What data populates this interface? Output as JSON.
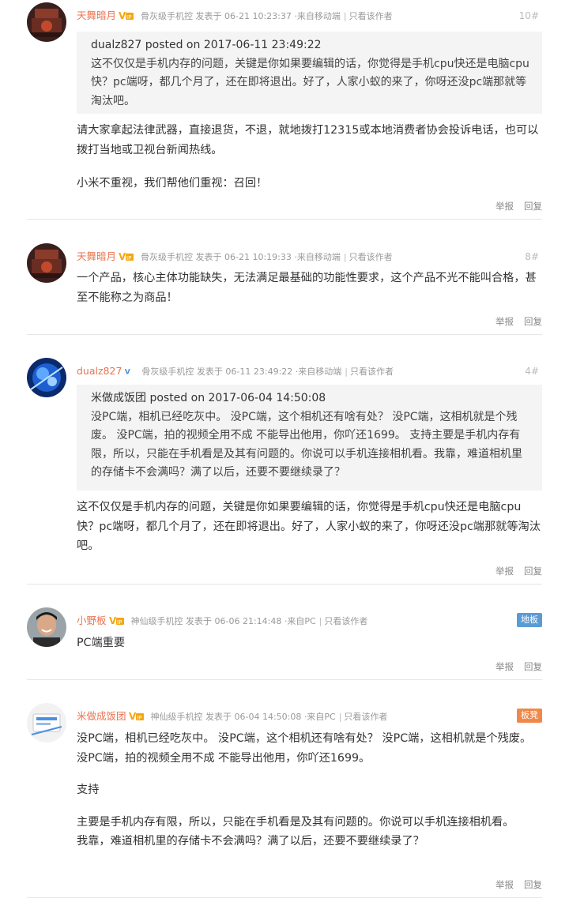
{
  "posts": [
    {
      "username": "天舞暗月",
      "rank": "骨灰级手机控",
      "posted_label": "发表于",
      "date": "06-21 10:23:37",
      "source": "·来自移动端",
      "only_author": "只看该作者",
      "floor": "10#",
      "quote": {
        "head": "dualz827 posted on 2017-06-11 23:49:22",
        "text": "这不仅仅是手机内存的问题，关键是你如果要编辑的话，你觉得是手机cpu快还是电脑cpu快？pc端呀，都几个月了，还在即将退出。好了，人家小蚁的来了，你呀还没pc端那就等淘汰吧。"
      },
      "paragraphs": [
        "请大家拿起法律武器，直接退货，不退，就地拨打12315或本地消费者协会投诉电话，也可以拨打当地或卫视台新闻热线。",
        "小米不重视，我们帮他们重视：召回！"
      ],
      "report": "举报",
      "reply": "回复"
    },
    {
      "username": "天舞暗月",
      "rank": "骨灰级手机控",
      "posted_label": "发表于",
      "date": "06-21 10:19:33",
      "source": "·来自移动端",
      "only_author": "只看该作者",
      "floor": "8#",
      "paragraphs": [
        "一个产品，核心主体功能缺失，无法满足最基础的功能性要求，这个产品不光不能叫合格，甚至不能称之为商品！"
      ],
      "report": "举报",
      "reply": "回复"
    },
    {
      "username": "dualz827",
      "rank": "骨灰级手机控",
      "posted_label": "发表于",
      "date": "06-11 23:49:22",
      "source": "·来自移动端",
      "only_author": "只看该作者",
      "floor": "4#",
      "quote": {
        "head": "米做成饭团 posted on 2017-06-04 14:50:08",
        "text": "没PC端，相机已经吃灰中。 没PC端，这个相机还有啥有处？ 没PC端，这相机就是个残废。 没PC端，拍的视频全用不成 不能导出他用，你吖还1699。 支持主要是手机内存有限，所以，只能在手机看是及其有问题的。你说可以手机连接相机看。我靠，难道相机里的存储卡不会满吗？满了以后，还要不要继续录了？"
      },
      "paragraphs": [
        "这不仅仅是手机内存的问题，关键是你如果要编辑的话，你觉得是手机cpu快还是电脑cpu快？pc端呀，都几个月了，还在即将退出。好了，人家小蚁的来了，你呀还没pc端那就等淘汰吧。"
      ],
      "report": "举报",
      "reply": "回复"
    },
    {
      "username": "小野板",
      "rank": "神仙级手机控",
      "posted_label": "发表于",
      "date": "06-06 21:14:48",
      "source": "·来自PC",
      "only_author": "只看该作者",
      "floor_badge": "地板",
      "paragraphs": [
        "PC端重要"
      ],
      "report": "举报",
      "reply": "回复"
    },
    {
      "username": "米做成饭团",
      "rank": "神仙级手机控",
      "posted_label": "发表于",
      "date": "06-04 14:50:08",
      "source": "·来自PC",
      "only_author": "只看该作者",
      "floor_badge": "板凳",
      "paragraphs": [
        "没PC端，相机已经吃灰中。 没PC端，这个相机还有啥有处？ 没PC端，这相机就是个残废。 没PC端，拍的视频全用不成 不能导出他用，你吖还1699。",
        "支持",
        "主要是手机内存有限，所以，只能在手机看是及其有问题的。你说可以手机连接相机看。\n我靠，难道相机里的存储卡不会满吗？满了以后，还要不要继续录了？"
      ],
      "report": "举报",
      "reply": "回复"
    }
  ],
  "colors": {
    "username": "#eb7350",
    "floor_badge_blue": "#5b9bd5",
    "floor_badge_orange": "#f0884a"
  },
  "icons": {
    "vip_badge": "vip-badge-icon",
    "verified_badge": "verified-v-icon"
  }
}
